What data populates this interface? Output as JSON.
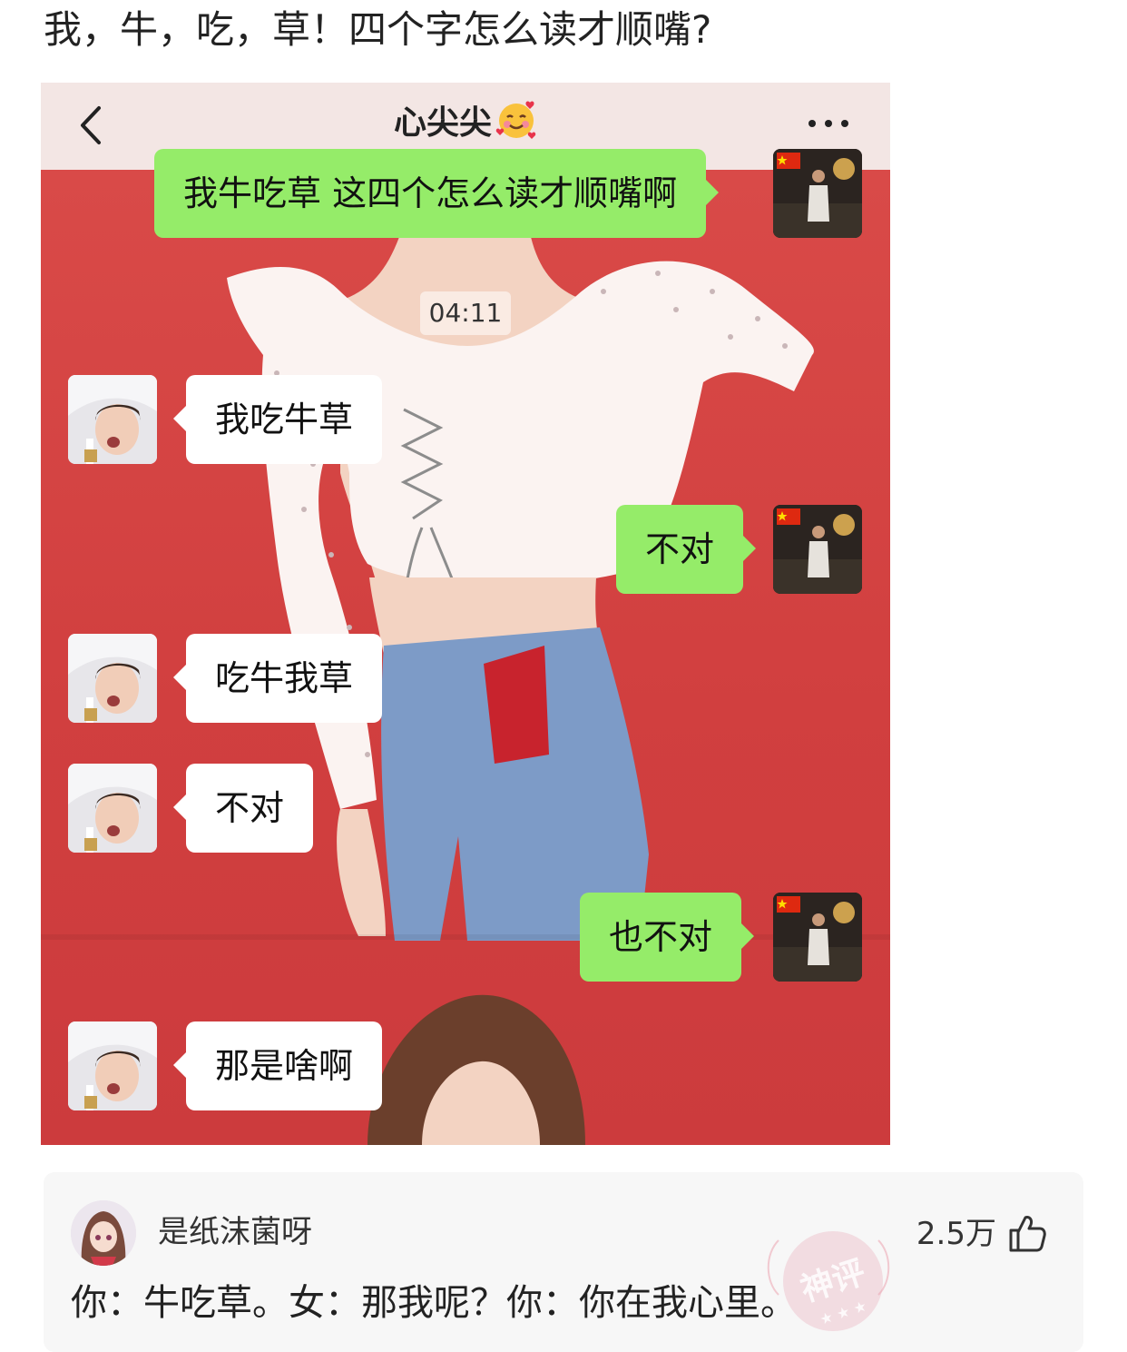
{
  "post": {
    "title": "我，牛，吃，草！四个字怎么读才顺嘴?"
  },
  "chat": {
    "header": {
      "title": "心尖尖",
      "title_emoji": "smiling-face-with-hearts-emoji"
    },
    "timestamp": "04:11",
    "colors": {
      "outgoing_bubble": "#95ec69",
      "incoming_bubble": "#ffffff",
      "background": "#d64343"
    },
    "messages": [
      {
        "sender": "me",
        "text": "我牛吃草  这四个怎么读才顺嘴啊"
      },
      {
        "sender": "her",
        "text": "我吃牛草"
      },
      {
        "sender": "me",
        "text": "不对"
      },
      {
        "sender": "her",
        "text": "吃牛我草"
      },
      {
        "sender": "her",
        "text": "不对"
      },
      {
        "sender": "me",
        "text": "也不对"
      },
      {
        "sender": "her",
        "text": "那是啥啊"
      }
    ]
  },
  "comment": {
    "username": "是纸沫菌呀",
    "likes": "2.5万",
    "text": "你：牛吃草。女：那我呢？你：你在我心里。",
    "badge_text": "神评",
    "badge_color": "#e9aab6"
  }
}
